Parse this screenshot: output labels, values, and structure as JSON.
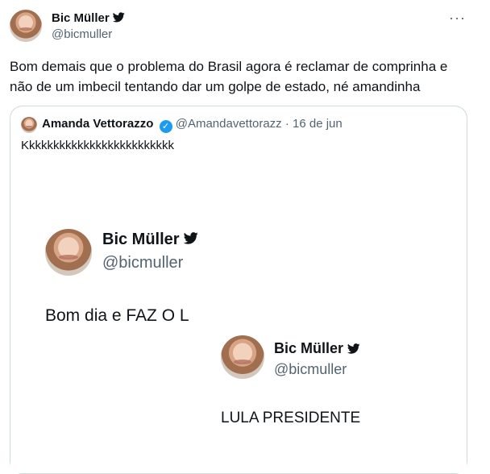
{
  "tweet": {
    "author_name": "Bic Müller",
    "author_handle": "@bicmuller",
    "more_label": "···",
    "text": "Bom demais que o problema do Brasil agora é reclamar de comprinha e não de um imbecil tentando dar um golpe de estado, né amandinha"
  },
  "quote": {
    "author_name": "Amanda Vettorazzo",
    "author_handle": "@Amandavettorazz",
    "separator": " · ",
    "date": "16 de jun",
    "text": "Kkkkkkkkkkkkkkkkkkkkkkkkk",
    "image": {
      "post1": {
        "name": "Bic Müller",
        "handle": "@bicmuller",
        "text": "Bom dia e FAZ O L"
      },
      "post2": {
        "name": "Bic Müller",
        "handle": "@bicmuller",
        "text": "LULA PRESIDENTE"
      }
    }
  },
  "colors": {
    "text": "#0f1419",
    "muted": "#536471",
    "border": "#cfd9de",
    "verified": "#1d9bf0"
  }
}
